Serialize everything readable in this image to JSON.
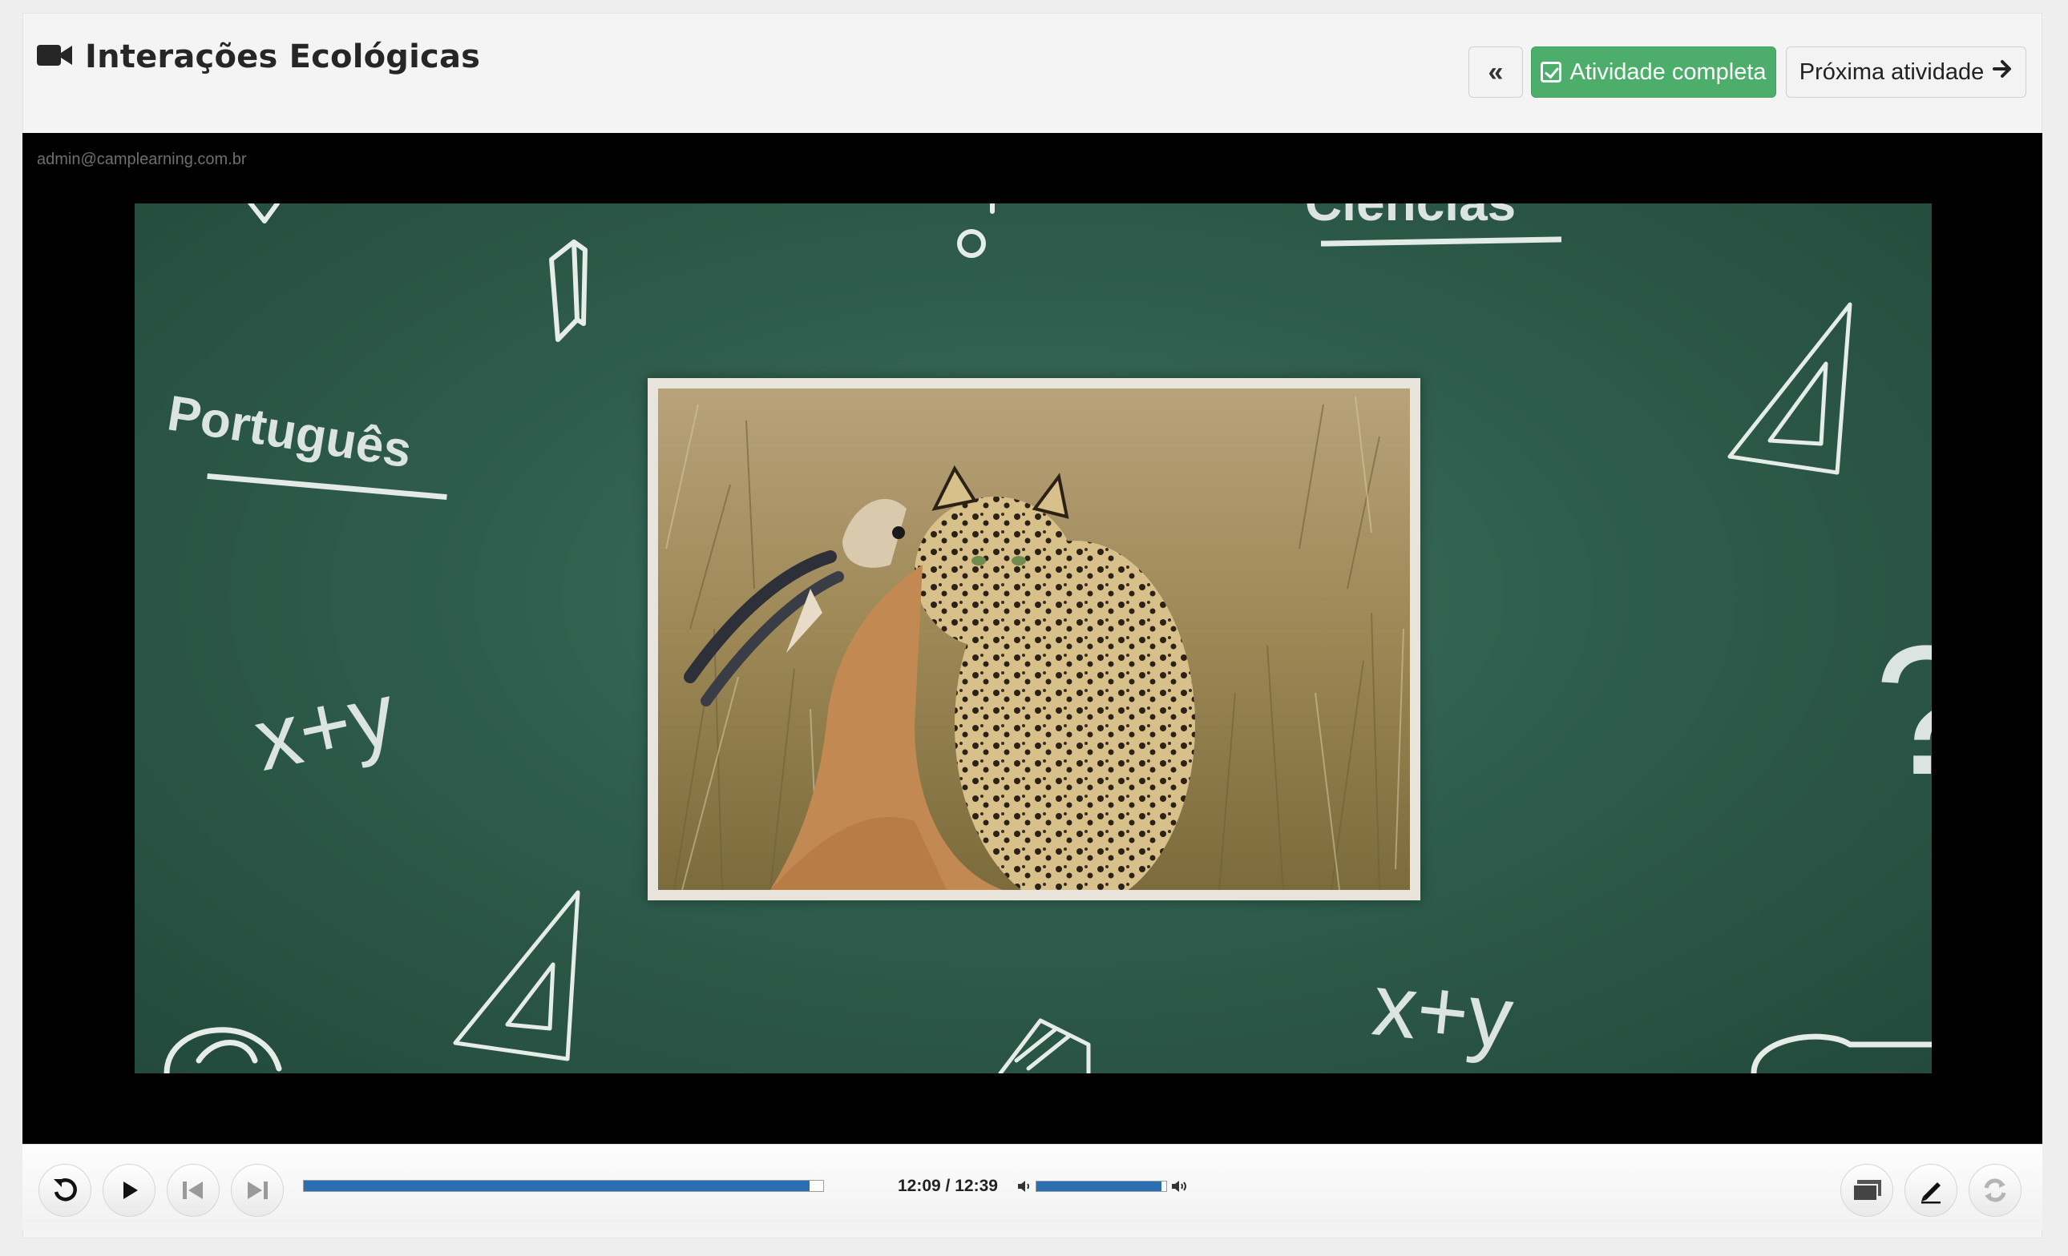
{
  "header": {
    "title": "Interações Ecológicas",
    "back_label": "«",
    "complete_label": "Atividade completa",
    "next_label": "Próxima atividade"
  },
  "player": {
    "watermark": "admin@camplearning.com.br",
    "chalk_texts": {
      "portugues": "Português",
      "ciencias": "Ciencias",
      "xy_left": "x+y",
      "xy_right": "x+y",
      "question": "?"
    },
    "time": "12:09 / 12:39",
    "progress": 0.974,
    "volume": 0.96
  },
  "colors": {
    "complete_green": "#4dae6c",
    "progress_blue": "#2b6fb3",
    "board_green": "#2f5d4d"
  },
  "icons": [
    "video-camera-icon",
    "double-chevron-left-icon",
    "checkbox-icon",
    "arrow-right-icon",
    "replay-icon",
    "play-icon",
    "previous-icon",
    "next-icon",
    "volume-low-icon",
    "volume-high-icon",
    "slides-icon",
    "pencil-icon",
    "sync-icon"
  ]
}
